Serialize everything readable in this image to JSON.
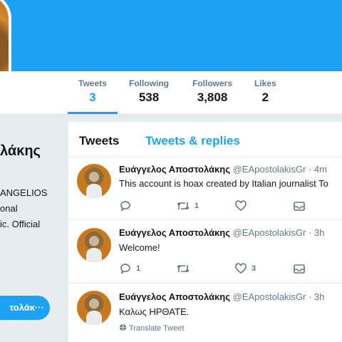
{
  "profile": {
    "name_fragment": "λάκης",
    "bio_lines": [
      "ANGELIOS",
      "onal",
      "ic. Official"
    ],
    "tweet_to_label": "τολάκ···"
  },
  "stats": [
    {
      "label": "Tweets",
      "value": "3",
      "active": true
    },
    {
      "label": "Following",
      "value": "538"
    },
    {
      "label": "Followers",
      "value": "3,808"
    },
    {
      "label": "Likes",
      "value": "2"
    }
  ],
  "timeline": {
    "tabs": [
      "Tweets",
      "Tweets & replies"
    ],
    "tweets": [
      {
        "name": "Ευάγγελος Αποστολάκης",
        "handle": "@EApostolakisGr · 4m",
        "text": "This account is hoax created by Italian journalist To",
        "reply_count": "",
        "retweet_count": "1",
        "like_count": ""
      },
      {
        "name": "Ευάγγελος Αποστολάκης",
        "handle": "@EApostolakisGr · 3h",
        "text": "Welcome!",
        "reply_count": "1",
        "retweet_count": "",
        "like_count": "3"
      },
      {
        "name": "Ευάγγελος Αποστολάκης",
        "handle": "@EApostolakisGr · 3h",
        "text": "Καλως ΗΡΘΑΤΕ.",
        "translate_label": "Translate Tweet"
      }
    ]
  },
  "colors": {
    "accent": "#1da1f2",
    "muted": "#657786",
    "background": "#e6ecf0"
  }
}
